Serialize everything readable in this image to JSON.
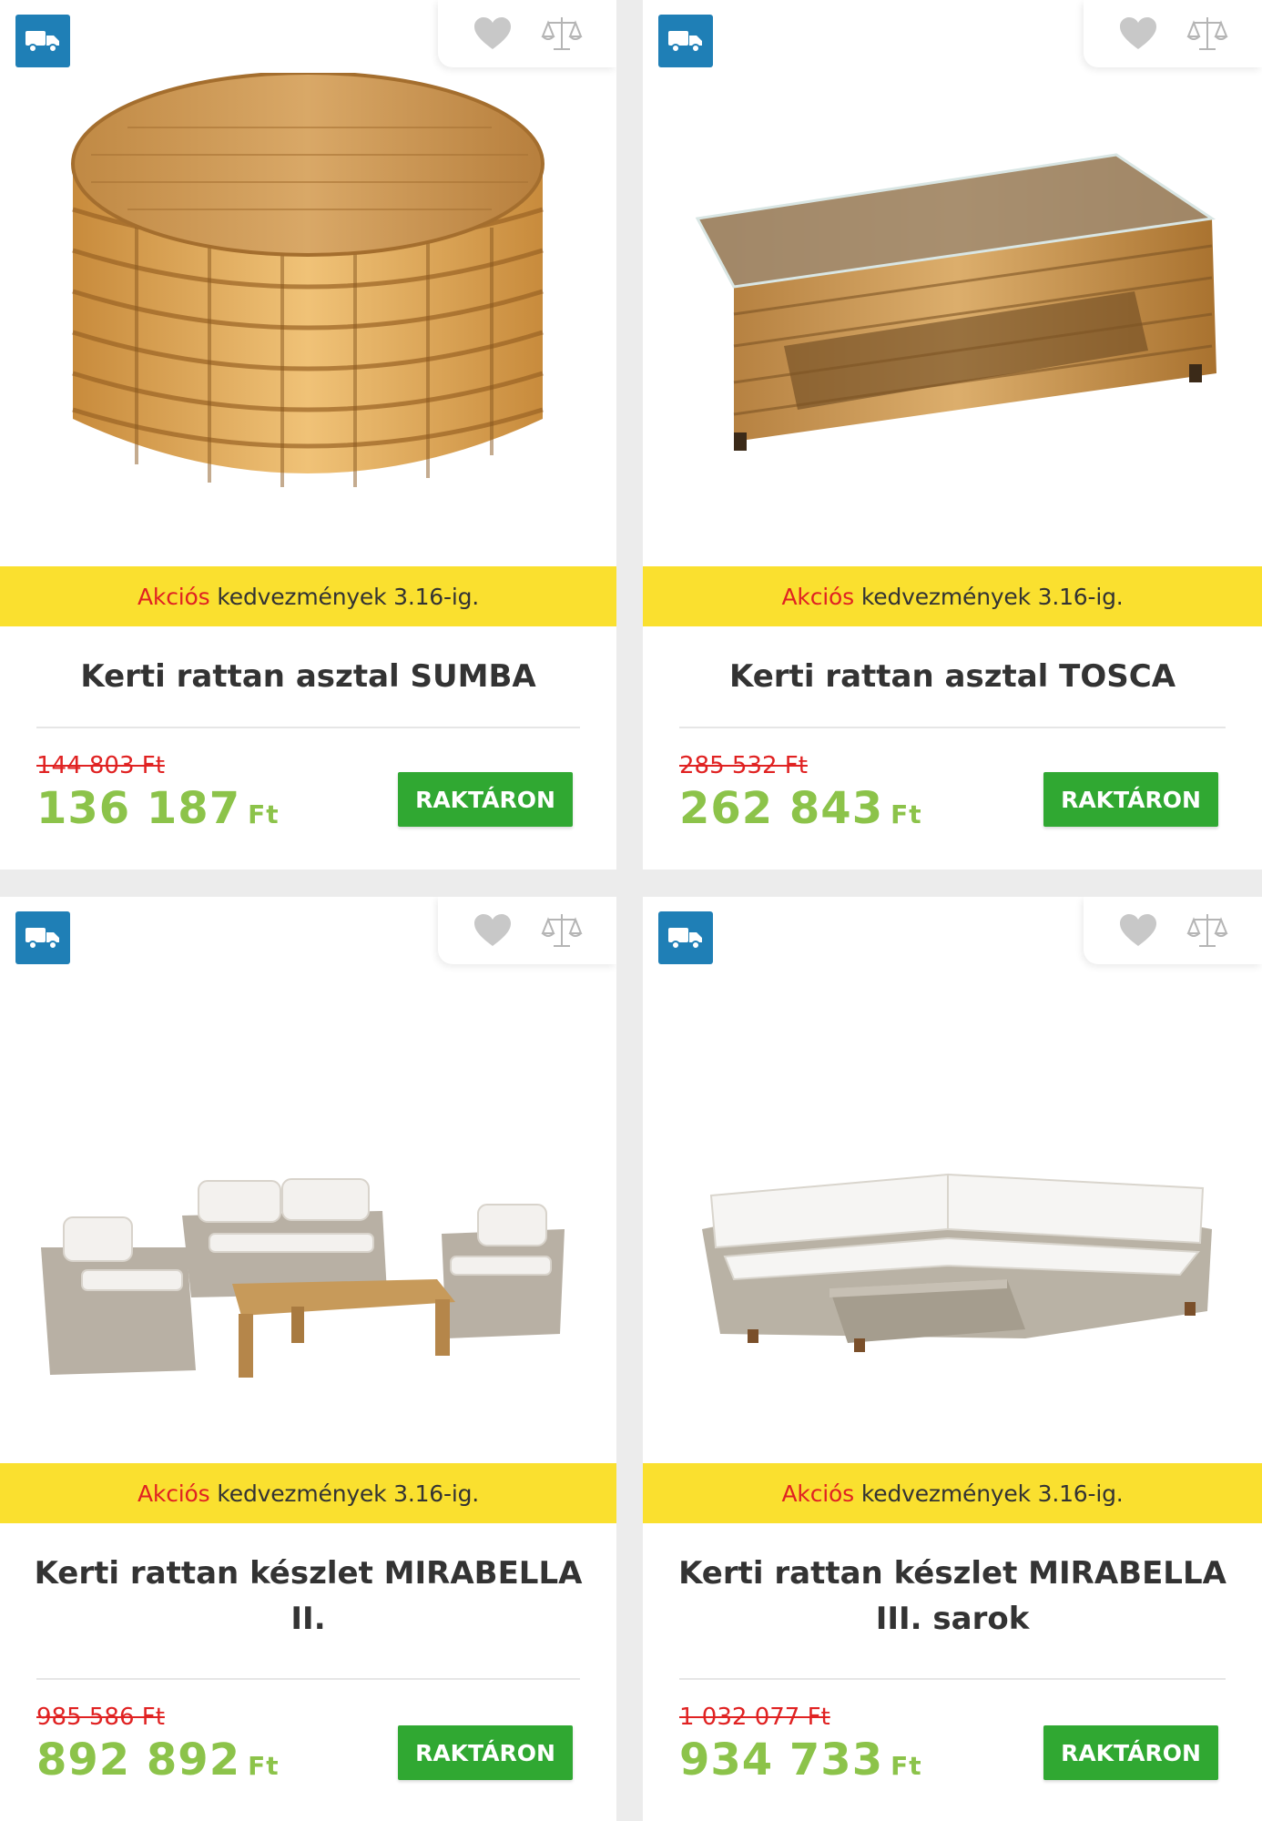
{
  "colors": {
    "accent_green": "#8cc34a",
    "stock_green": "#30a832",
    "promo_yellow": "#fae02f",
    "sale_red": "#e02222",
    "truck_blue": "#1f7fb6"
  },
  "icons": {
    "delivery": "truck-icon",
    "wishlist": "heart-icon",
    "compare": "scale-icon"
  },
  "products": [
    {
      "promo_highlight": "Akciós",
      "promo_text": "kedvezmények 3.16-ig.",
      "title": "Kerti rattan asztal SUMBA",
      "old_price": "144 803 Ft",
      "price": "136 187",
      "currency": "Ft",
      "stock_label": "RAKTÁRON"
    },
    {
      "promo_highlight": "Akciós",
      "promo_text": "kedvezmények 3.16-ig.",
      "title": "Kerti rattan asztal TOSCA",
      "old_price": "285 532 Ft",
      "price": "262 843",
      "currency": "Ft",
      "stock_label": "RAKTÁRON"
    },
    {
      "promo_highlight": "Akciós",
      "promo_text": "kedvezmények 3.16-ig.",
      "title": "Kerti rattan készlet MIRABELLA II.",
      "old_price": "985 586 Ft",
      "price": "892 892",
      "currency": "Ft",
      "stock_label": "RAKTÁRON"
    },
    {
      "promo_highlight": "Akciós",
      "promo_text": "kedvezmények 3.16-ig.",
      "title": "Kerti rattan készlet MIRABELLA III. sarok",
      "old_price": "1 032 077 Ft",
      "price": "934 733",
      "currency": "Ft",
      "stock_label": "RAKTÁRON"
    }
  ]
}
